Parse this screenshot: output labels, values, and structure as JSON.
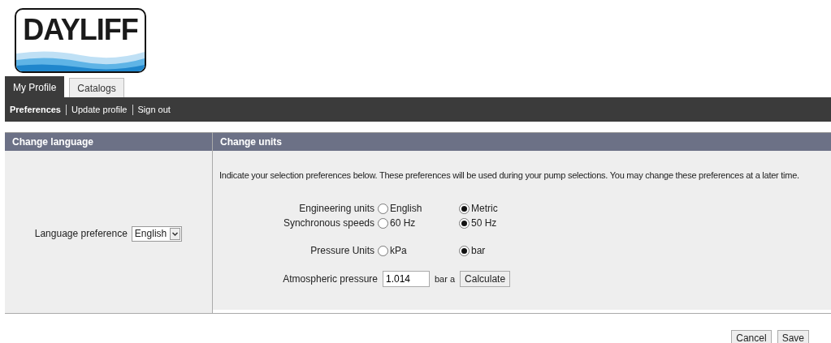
{
  "logo": {
    "text": "DAYLIFF"
  },
  "tabs": [
    {
      "label": "My Profile",
      "selected": true
    },
    {
      "label": "Catalogs",
      "selected": false
    }
  ],
  "subnav": [
    {
      "label": "Preferences",
      "selected": true
    },
    {
      "label": "Update profile",
      "selected": false
    },
    {
      "label": "Sign out",
      "selected": false
    }
  ],
  "language_panel": {
    "title": "Change language",
    "label": "Language preference",
    "value": "English"
  },
  "units_panel": {
    "title": "Change units",
    "intro": "Indicate your selection preferences below. These preferences will be used during your pump selections. You may change these preferences at a later time.",
    "groups": [
      {
        "label": "Engineering units",
        "options": [
          {
            "label": "English",
            "selected": false
          },
          {
            "label": "Metric",
            "selected": true
          }
        ]
      },
      {
        "label": "Synchronous speeds",
        "options": [
          {
            "label": "60 Hz",
            "selected": false
          },
          {
            "label": "50 Hz",
            "selected": true
          }
        ]
      },
      {
        "label": "Pressure Units",
        "options": [
          {
            "label": "kPa",
            "selected": false
          },
          {
            "label": "bar",
            "selected": true
          }
        ]
      }
    ],
    "atmospheric": {
      "label": "Atmospheric pressure",
      "value": "1.014",
      "unit": "bar a",
      "button": "Calculate"
    }
  },
  "buttons": [
    "Cancel",
    "Save"
  ]
}
